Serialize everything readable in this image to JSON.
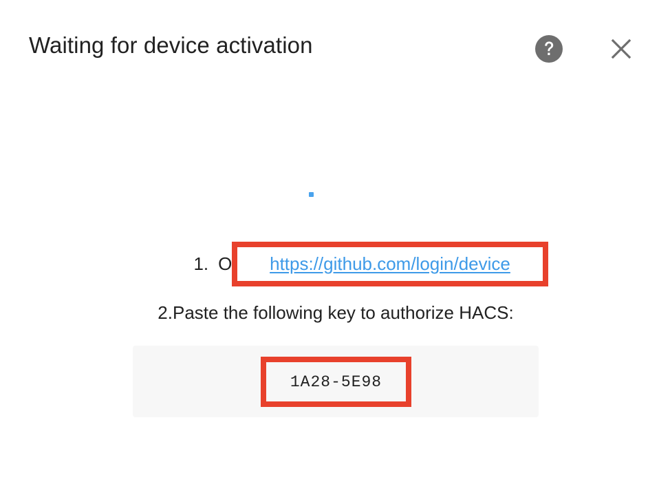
{
  "dialog": {
    "title": "Waiting for device activation",
    "help_icon": "help-circle-icon",
    "close_icon": "close-icon"
  },
  "steps": {
    "step1_number": "1.",
    "step1_text": "Open",
    "link": "https://github.com/login/device",
    "step2_text": "2.Paste the following key to authorize HACS:"
  },
  "device_code": "1A28-5E98",
  "colors": {
    "highlight": "#e8412c",
    "link": "#3e9ae8",
    "spinner": "#4aa3ed",
    "code_background": "#f7f7f7"
  }
}
